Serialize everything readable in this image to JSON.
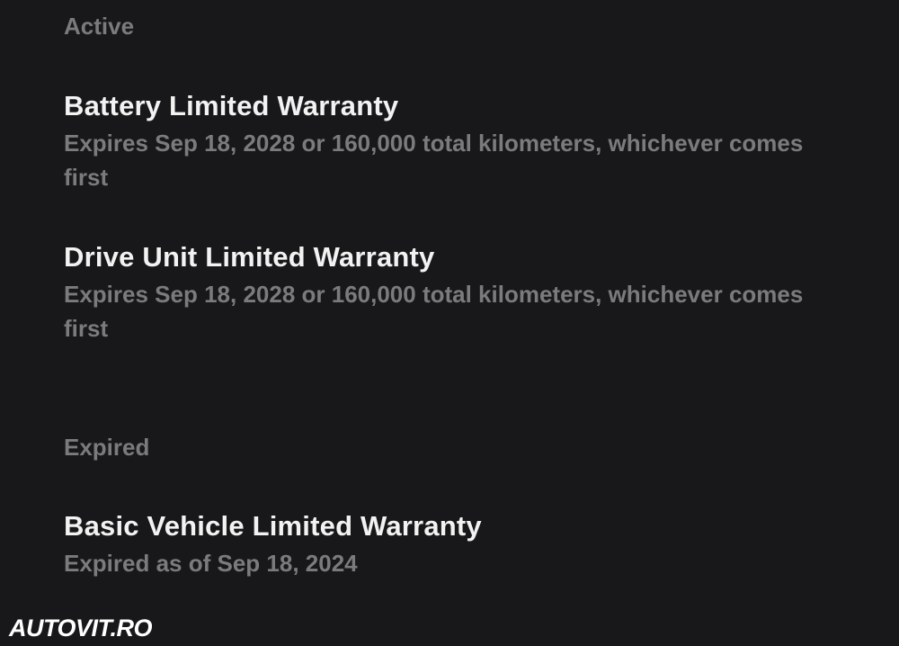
{
  "sections": {
    "active": {
      "header": "Active",
      "items": [
        {
          "title": "Battery Limited Warranty",
          "detail": "Expires Sep 18, 2028 or 160,000 total kilometers, whichever comes first"
        },
        {
          "title": "Drive Unit Limited Warranty",
          "detail": "Expires Sep 18, 2028 or 160,000 total kilometers, whichever comes first"
        }
      ]
    },
    "expired": {
      "header": "Expired",
      "items": [
        {
          "title": "Basic Vehicle Limited Warranty",
          "detail": "Expired as of Sep 18, 2024"
        }
      ]
    }
  },
  "watermark": "AUTOVIT.RO"
}
